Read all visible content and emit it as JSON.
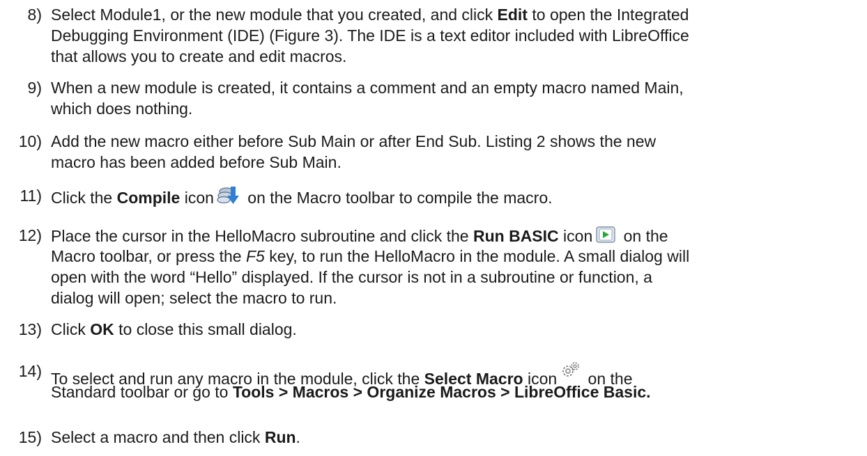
{
  "steps": [
    {
      "number": "8)",
      "lines": [
        [
          "Select Module1, or the new module that you created, and click ",
          "Edit",
          " to open the Integrated"
        ],
        "Debugging Environment (IDE) (Figure 3). The IDE is a text editor included with LibreOffice",
        "that allows you to create and edit macros."
      ]
    },
    {
      "number": "9)",
      "lines": [
        "When a new module is created, it contains a comment and an empty macro named Main,",
        "which does nothing."
      ]
    },
    {
      "number": "10)",
      "lines": [
        "Add the new macro either before Sub Main or after End Sub. Listing 2 shows the new",
        "macro has been added before Sub Main."
      ]
    },
    {
      "number": "11)",
      "lines": [
        [
          "Click the ",
          "Compile",
          " icon",
          " on the Macro toolbar to compile the macro."
        ]
      ],
      "icon": "compile-icon"
    },
    {
      "number": "12)",
      "lines": [
        [
          "Place the cursor in the HelloMacro subroutine and click the ",
          "Run BASIC",
          " icon",
          " on the"
        ],
        [
          "Macro toolbar, or press the ",
          "F5",
          " key, to run the HelloMacro in the module. A small dialog will"
        ],
        "open with the word “Hello” displayed. If the cursor is not in a subroutine or function, a",
        "dialog will open; select the macro to run."
      ],
      "icon": "run-basic-icon"
    },
    {
      "number": "13)",
      "lines": [
        [
          "Click ",
          "OK",
          " to close this small dialog."
        ]
      ]
    },
    {
      "number": "14)",
      "lines": [
        [
          "To select and run any macro in the module, click the ",
          "Select Macro",
          " icon",
          " on the"
        ],
        [
          "Standard toolbar or go to ",
          "Tools > Macros > Organize Macros > LibreOffice Basic."
        ]
      ],
      "icon": "select-macro-icon"
    },
    {
      "number": "15)",
      "lines": [
        [
          "Select a macro and then click ",
          "Run",
          "."
        ]
      ]
    }
  ]
}
